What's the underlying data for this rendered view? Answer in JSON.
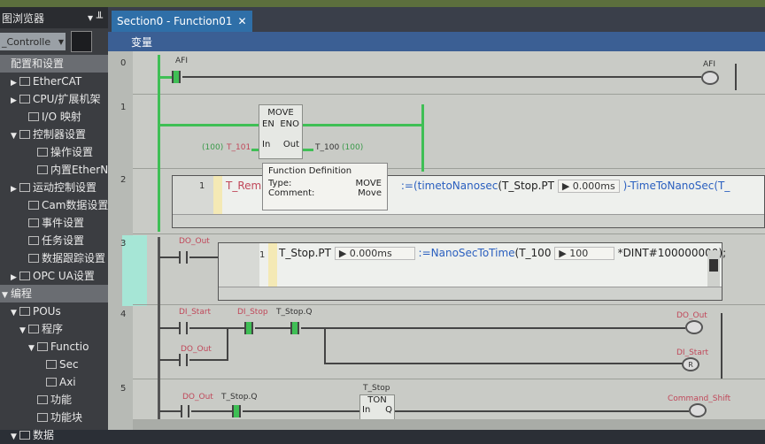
{
  "left_panel": {
    "title": "图浏览器",
    "title_icons": "▾ ╨",
    "combo_value": "_Controlle",
    "tree": [
      {
        "label": "配置和设置",
        "level": 0,
        "tri": "",
        "icon": false,
        "section": true
      },
      {
        "label": "EtherCAT",
        "level": 1,
        "tri": "▶",
        "icon": true
      },
      {
        "label": "CPU/扩展机架",
        "level": 1,
        "tri": "▶",
        "icon": true
      },
      {
        "label": "I/O 映射",
        "level": 2,
        "tri": "",
        "icon": true
      },
      {
        "label": "控制器设置",
        "level": 1,
        "tri": "▼",
        "icon": true
      },
      {
        "label": "操作设置",
        "level": 3,
        "tri": "",
        "icon": true
      },
      {
        "label": "内置EtherN",
        "level": 3,
        "tri": "",
        "icon": true
      },
      {
        "label": "运动控制设置",
        "level": 1,
        "tri": "▶",
        "icon": true
      },
      {
        "label": "Cam数据设置",
        "level": 2,
        "tri": "",
        "icon": true
      },
      {
        "label": "事件设置",
        "level": 2,
        "tri": "",
        "icon": true
      },
      {
        "label": "任务设置",
        "level": 2,
        "tri": "",
        "icon": true
      },
      {
        "label": "数据跟踪设置",
        "level": 2,
        "tri": "",
        "icon": true
      },
      {
        "label": "OPC UA设置",
        "level": 1,
        "tri": "▶",
        "icon": true
      },
      {
        "label": "编程",
        "level": 0,
        "tri": "▼",
        "icon": false,
        "section": true
      },
      {
        "label": "POUs",
        "level": 1,
        "tri": "▼",
        "icon": true
      },
      {
        "label": "程序",
        "level": 2,
        "tri": "▼",
        "icon": true
      },
      {
        "label": "Functio",
        "level": 3,
        "tri": "▼",
        "icon": true
      },
      {
        "label": "Sec",
        "level": 4,
        "tri": "",
        "icon": true
      },
      {
        "label": "Axi",
        "level": 4,
        "tri": "",
        "icon": true
      },
      {
        "label": "功能",
        "level": 3,
        "tri": "",
        "icon": true
      },
      {
        "label": "功能块",
        "level": 3,
        "tri": "",
        "icon": true
      },
      {
        "label": "数据",
        "level": 1,
        "tri": "▼",
        "icon": true
      }
    ]
  },
  "tab": {
    "label": "Section0 - Function01",
    "close": "✕"
  },
  "var_bar": {
    "label": "变量"
  },
  "rungs": {
    "r0": "0",
    "r1": "1",
    "r2": "2",
    "r3": "3",
    "r4": "4",
    "r5": "5"
  },
  "rung0": {
    "contact": "AFI",
    "coil": "AFI"
  },
  "rung1": {
    "block_title": "MOVE",
    "en": "EN",
    "eno": "ENO",
    "in": "In",
    "out": "Out",
    "in_val": "(100)",
    "in_var": "T_101",
    "out_var": "T_100",
    "out_val": "(100)"
  },
  "tooltip": {
    "title": "Function Definition",
    "type_label": "Type:",
    "type_value": "MOVE",
    "comment_label": "Comment:",
    "comment_value": "Move"
  },
  "rung2": {
    "line": "1",
    "lhs": "T_Rem",
    "assign": ":=(",
    "fn1": "timetoNanosec",
    "arg": "(T_Stop.PT",
    "val": "0.000ms",
    "rest": ")-TimeToNanoSec(T_"
  },
  "rung3": {
    "contact": "DO_Out",
    "line": "1",
    "lhs": "T_Stop.PT",
    "lhs_val": "0.000ms",
    "assign": ":=",
    "fn": "NanoSecToTime",
    "arg": "(T_100",
    "arg_val": "100",
    "rest": "*DINT#100000000);"
  },
  "rung4": {
    "c1": "DI_Start",
    "c2": "DI_Stop",
    "c3": "T_Stop.Q",
    "coil1": "DO_Out",
    "c4": "DO_Out",
    "coil2": "DI_Start",
    "reset": "R"
  },
  "rung5": {
    "c1": "DO_Out",
    "c2": "T_Stop.Q",
    "timer_name": "T_Stop",
    "timer_type": "TON",
    "timer_in": "In",
    "timer_q": "Q",
    "coil": "Command_Shift"
  }
}
